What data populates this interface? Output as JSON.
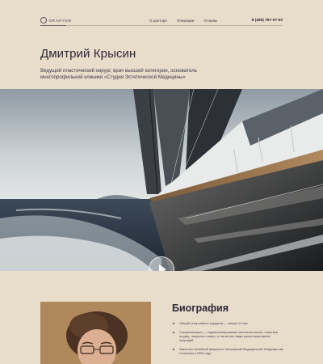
{
  "header": {
    "brand": "DR.KRYSIN",
    "nav": [
      "О докторе",
      "Операции",
      "Отзывы"
    ],
    "phone": "8 (495) 767-07-00"
  },
  "hero": {
    "title": "Дмитрий Крысин",
    "subtitle": "Ведущий пластический хирург, врач высшей категории, основатель многопрофильной клиники «Студия Эстетической Медицины»",
    "image_icon": "sailing-yacht-photo",
    "play_icon": "play-icon"
  },
  "bio": {
    "title": "Биография",
    "items": [
      "Общий стаж работы хирургом — свыше 24 лет.",
      "Специализация — эндопротезирование молочных желез, пластика ягодиц, лазерного нания, а так же все виды реконструктивных операций.",
      "Закончил лечебный факультет Московской Медицинской Академии им. Сеченова в 1993 году."
    ]
  },
  "colors": {
    "background": "#e8dccb",
    "text": "#2b2730",
    "rule": "#bfb3a3"
  }
}
